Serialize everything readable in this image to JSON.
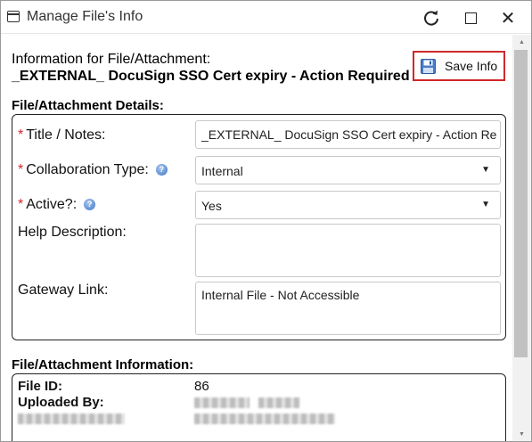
{
  "window": {
    "title": "Manage File's Info"
  },
  "header": {
    "info_label": "Information for File/Attachment:",
    "file_name": "_EXTERNAL_ DocuSign SSO Cert expiry - Action Required"
  },
  "toolbar": {
    "save_label": "Save Info"
  },
  "details": {
    "section_title": "File/Attachment Details:",
    "title_label": "Title / Notes:",
    "title_value": "_EXTERNAL_ DocuSign SSO Cert expiry - Action Re",
    "collab_label": "Collaboration Type:",
    "collab_value": "Internal",
    "active_label": "Active?:",
    "active_value": "Yes",
    "help_label": "Help Description:",
    "help_value": "",
    "gateway_label": "Gateway Link:",
    "gateway_value": "Internal File - Not Accessible"
  },
  "info": {
    "section_title": "File/Attachment Information:",
    "file_id_label": "File ID:",
    "file_id_value": "86",
    "uploaded_by_label": "Uploaded By:"
  },
  "icons": {
    "refresh": "refresh-icon",
    "maximize": "maximize-icon",
    "close": "close-icon",
    "save": "floppy-disk-icon",
    "help": "help-icon"
  },
  "colors": {
    "accent_red": "#d0282c",
    "help_blue": "#3d73c4"
  }
}
